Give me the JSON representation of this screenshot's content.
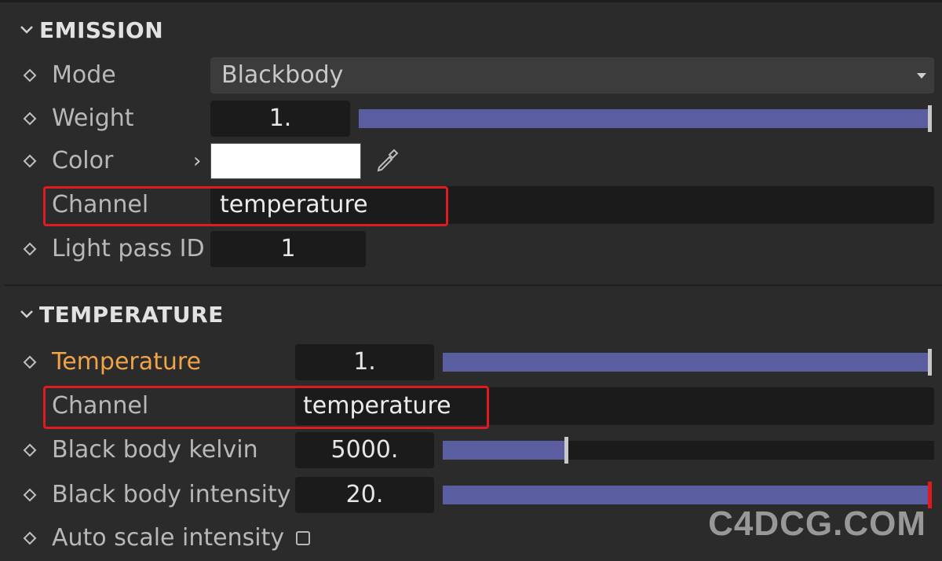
{
  "emission": {
    "title": "EMISSION",
    "mode": {
      "label": "Mode",
      "value": "Blackbody"
    },
    "weight": {
      "label": "Weight",
      "value": "1.",
      "level": 1.0
    },
    "color": {
      "label": "Color",
      "swatch": "#ffffff"
    },
    "channel": {
      "label": "Channel",
      "value": "temperature"
    },
    "light_pass": {
      "label": "Light pass ID",
      "value": "1"
    }
  },
  "temperature": {
    "title": "TEMPERATURE",
    "temperature": {
      "label": "Temperature",
      "value": "1.",
      "level": 1.0
    },
    "channel": {
      "label": "Channel",
      "value": "temperature"
    },
    "kelvin": {
      "label": "Black body kelvin",
      "value": "5000.",
      "level": 0.25
    },
    "intensity": {
      "label": "Black body intensity",
      "value": "20.",
      "level": 1.0
    },
    "auto_scale": {
      "label": "Auto scale intensity",
      "checked": false
    }
  },
  "watermark": "C4DCG.COM",
  "colors": {
    "accent_fill": "#5a5ea0",
    "active_label": "#f0a347",
    "highlight": "#e01b1f"
  }
}
